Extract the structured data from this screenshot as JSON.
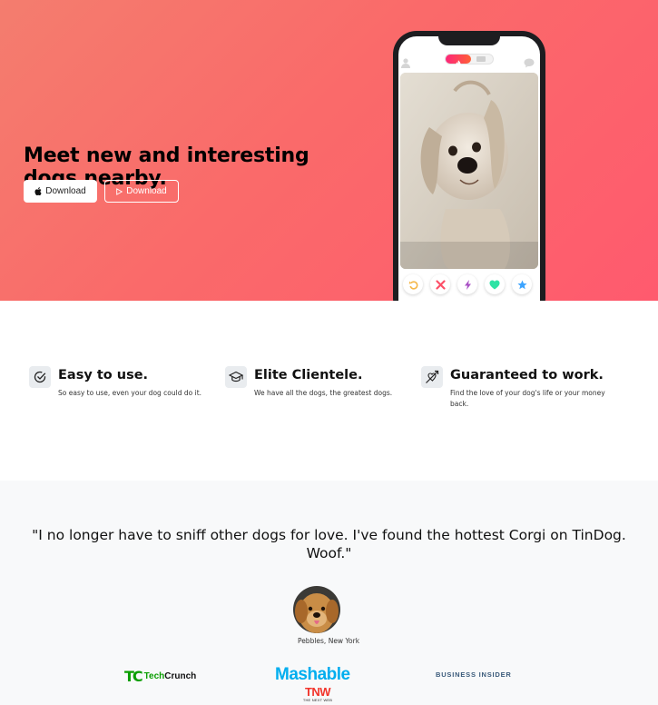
{
  "hero": {
    "title": "Meet new and interesting dogs nearby.",
    "buttons": [
      {
        "label": "Download",
        "icon": "apple-icon"
      },
      {
        "label": "Download",
        "icon": "google-play-icon"
      }
    ]
  },
  "phone": {
    "icons": [
      "user-icon",
      "flame-icon",
      "chat-icon"
    ],
    "action_icons": [
      "rewind-icon",
      "nope-icon",
      "boost-icon",
      "like-icon",
      "super-like-icon"
    ],
    "colors": {
      "rewind": "#f5b748",
      "nope": "#fd5068",
      "boost": "#a84fc4",
      "like": "#2fe3a5",
      "star": "#3ca4ff"
    }
  },
  "features": [
    {
      "icon": "check-circle-icon",
      "title": "Easy to use.",
      "text": "So easy to use, even your dog could do it."
    },
    {
      "icon": "graduation-cap-icon",
      "title": "Elite Clientele.",
      "text": "We have all the dogs, the greatest dogs."
    },
    {
      "icon": "heart-arrow-icon",
      "title": "Guaranteed to work.",
      "text": "Find the love of your dog's life or your money back."
    }
  ],
  "testimonial": {
    "quote": "\"I no longer have to sniff other dogs for love. I've found the hottest Corgi on TinDog. Woof.\"",
    "author": "Pebbles, New York"
  },
  "press": {
    "techcrunch": {
      "mark": "TC",
      "text_a": "Tech",
      "text_b": "Crunch"
    },
    "mashable": "Mashable",
    "business_insider": "BUSINESS INSIDER",
    "tnw": {
      "mark": "TNW",
      "sub": "THE NEXT WEB"
    }
  },
  "colors": {
    "hero_gradient_start": "#f47d6e",
    "hero_gradient_end": "#ff5a6e",
    "section_bg": "#f8f9fa"
  }
}
